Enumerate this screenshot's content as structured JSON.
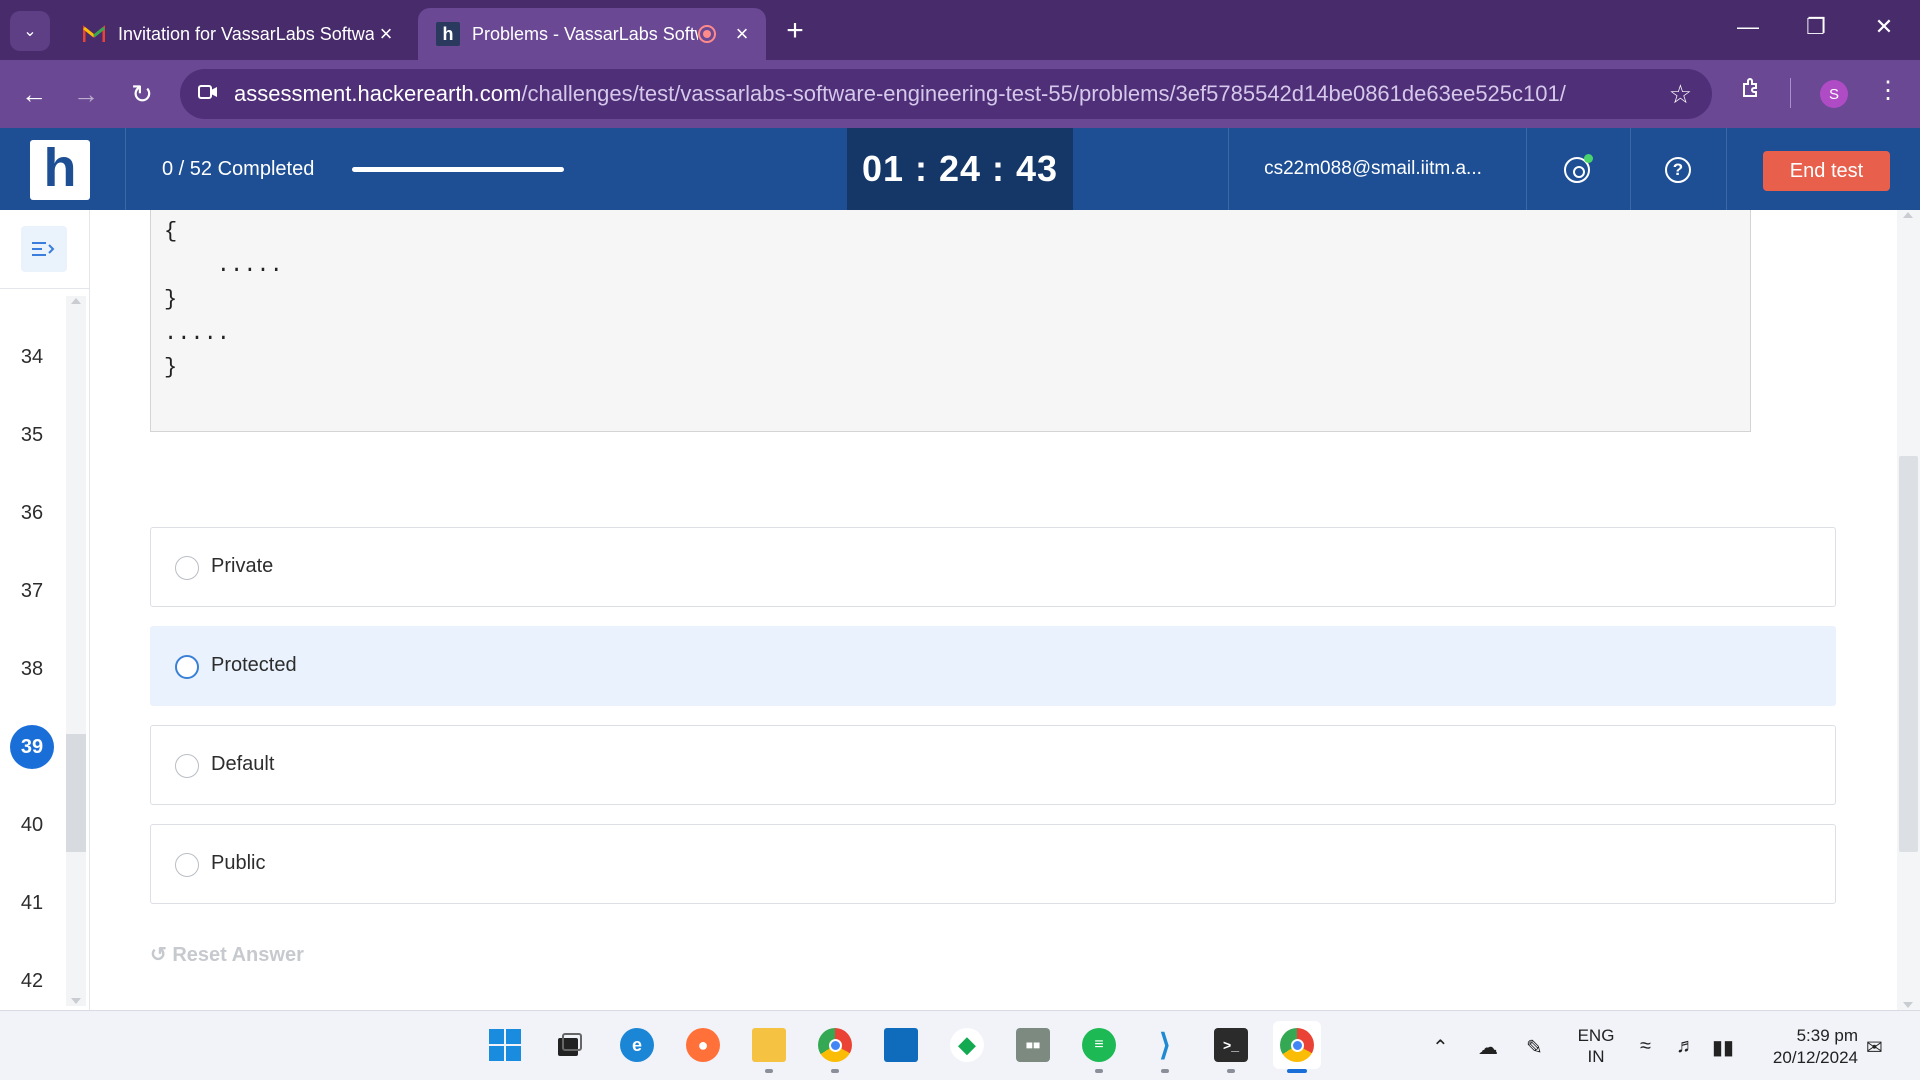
{
  "browser": {
    "tabs": [
      {
        "title": "Invitation for VassarLabs Software Engineering Test",
        "favicon": "gmail-icon",
        "active": false
      },
      {
        "title": "Problems - VassarLabs Software Engineering Test",
        "favicon": "hackerearth-icon",
        "active": true
      }
    ],
    "url_host": "assessment.hackerearth.com",
    "url_path": "/challenges/test/vassarlabs-software-engineering-test-55/problems/3ef5785542d14be0861de63ee525c101/",
    "profile_initial": "S"
  },
  "header": {
    "logo_letter": "h",
    "progress_text": "0 / 52 Completed",
    "progress_fraction": 0,
    "timer": "01 : 24 : 43",
    "email": "cs22m088@smail.iitm.a...",
    "end_test_label": "End test"
  },
  "question_nav": {
    "numbers": [
      "34",
      "35",
      "36",
      "37",
      "38",
      "39",
      "40",
      "41",
      "42"
    ],
    "current": "39"
  },
  "code_snippet": {
    "lines": [
      "{",
      "    .....",
      "}",
      ".....",
      "}"
    ]
  },
  "options": [
    {
      "label": "Private",
      "selected": false
    },
    {
      "label": "Protected",
      "selected": false
    },
    {
      "label": "Default",
      "selected": false
    },
    {
      "label": "Public",
      "selected": false
    }
  ],
  "reset_answer_label": "Reset Answer",
  "taskbar": {
    "apps": [
      "windows-start-icon",
      "task-view-icon",
      "edge-icon",
      "firefox-icon",
      "file-explorer-icon",
      "chrome-icon",
      "windows-store-icon",
      "mongodb-icon",
      "film-editor-icon",
      "spotify-icon",
      "vscode-icon",
      "terminal-icon",
      "chrome-profile-icon"
    ],
    "language_line1": "ENG",
    "language_line2": "IN",
    "time": "5:39 pm",
    "date": "20/12/2024"
  },
  "colors": {
    "tab_strip": "#472b6a",
    "toolbar": "#6a4894",
    "header": "#1e4f94",
    "timer_bg": "#143768",
    "end_test": "#e8604c",
    "current_question": "#1a6ed8",
    "option_hover": "#e9f2fd"
  }
}
